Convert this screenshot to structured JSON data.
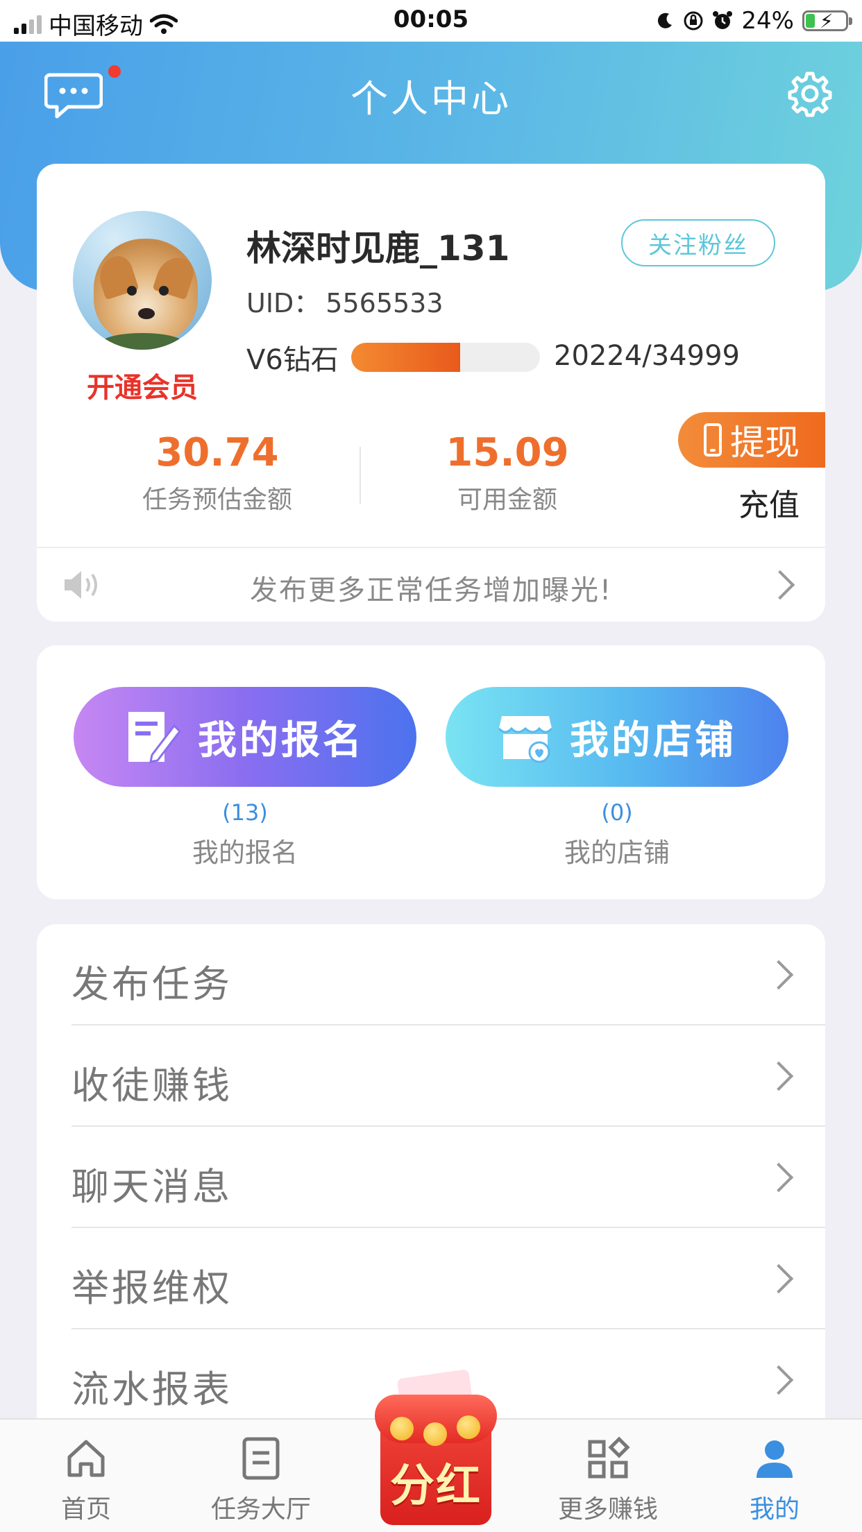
{
  "status_bar": {
    "carrier": "中国移动",
    "time": "00:05",
    "battery": "24%",
    "battery_level": 0.24
  },
  "header": {
    "title": "个人中心",
    "message_icon": "chat-bubble-icon",
    "settings_icon": "gear-icon"
  },
  "profile": {
    "username": "林深时见鹿_131",
    "follow_label": "关注粉丝",
    "uid_label": "UID：",
    "uid_value": "5565533",
    "vip_label": "开通会员",
    "level_label": "V6钻石",
    "level_progress_text": "20224/34999",
    "level_progress_fraction": 0.578,
    "stats": [
      {
        "value": "30.74",
        "label": "任务预估金额"
      },
      {
        "value": "15.09",
        "label": "可用金额"
      }
    ],
    "withdraw_label": "提现",
    "recharge_label": "充值",
    "notice": "发布更多正常任务增加曝光!"
  },
  "entries": [
    {
      "button": "我的报名",
      "count": "(13)",
      "label": "我的报名",
      "icon": "signup-edit-icon"
    },
    {
      "button": "我的店铺",
      "count": "(0)",
      "label": "我的店铺",
      "icon": "shop-store-icon"
    }
  ],
  "menu": [
    "发布任务",
    "收徒赚钱",
    "聊天消息",
    "举报维权",
    "流水报表"
  ],
  "tabbar": {
    "items": [
      {
        "label": "首页",
        "icon": "home-icon"
      },
      {
        "label": "任务大厅",
        "icon": "task-list-icon"
      },
      {
        "label": "更多赚钱",
        "icon": "apps-grid-icon"
      },
      {
        "label": "我的",
        "icon": "user-icon"
      }
    ],
    "center_label": "分红",
    "center_icon": "red-envelope-icon",
    "active_color": "#3b8fe0"
  },
  "colors": {
    "accent_orange": "#ee6f2d",
    "vip_red": "#e8332a",
    "follow_teal": "#5dc7d9"
  }
}
